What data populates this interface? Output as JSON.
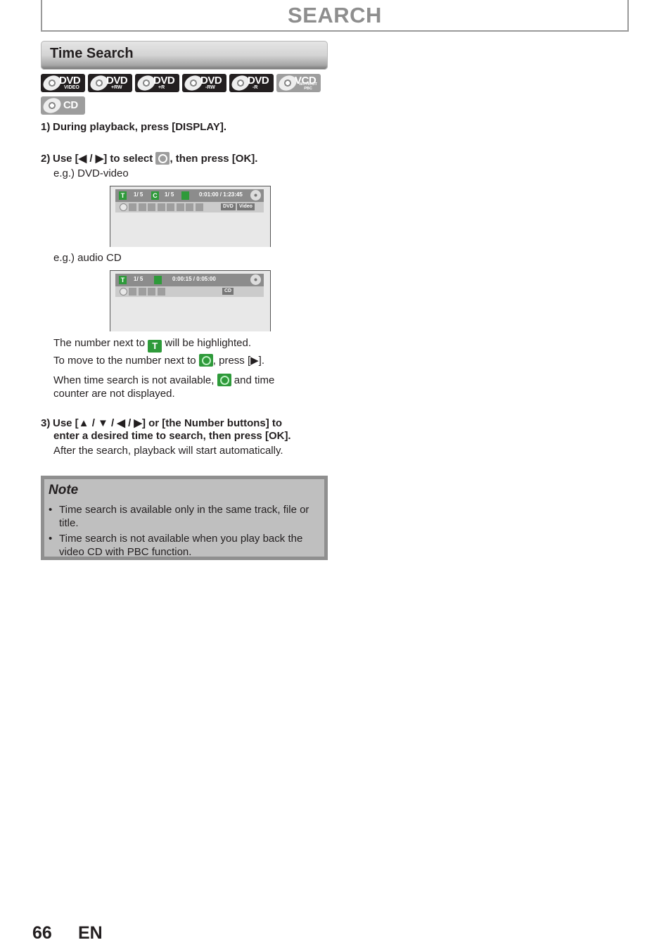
{
  "header": {
    "title": "SEARCH"
  },
  "section": {
    "title": "Time Search"
  },
  "disc_badges": [
    {
      "name": "DVD",
      "sub": "VIDEO",
      "style": "dark"
    },
    {
      "name": "DVD",
      "sub": "+RW",
      "style": "dark"
    },
    {
      "name": "DVD",
      "sub": "+R",
      "style": "dark"
    },
    {
      "name": "DVD",
      "sub": "-RW",
      "style": "dark"
    },
    {
      "name": "DVD",
      "sub": "-R",
      "style": "dark"
    },
    {
      "name": "VCD",
      "sub": "WITHOUT PBC",
      "style": "gray"
    },
    {
      "name": "CD",
      "sub": "",
      "style": "gray"
    }
  ],
  "steps": [
    {
      "num": "1)",
      "text": "During playback, press [DISPLAY]."
    },
    {
      "num": "2)",
      "text_before": "Use [◀ / ▶] to select",
      "icon": "time-search-icon",
      "text_after": ", then press [OK]."
    },
    {
      "num": "3)",
      "line1": "Use [▲ / ▼ / ◀ / ▶] or [the Number buttons] to",
      "line2": "enter a desired time to search, then press [OK].",
      "sub": "After the search, playback will start automatically."
    }
  ],
  "examples": {
    "dvd": {
      "label": "e.g.) DVD-video",
      "title_badge": "T",
      "title_value": "1/   5",
      "chapter_badge": "C",
      "chapter_value": "1/   5",
      "time": "0:01:00 / 1:23:45",
      "tags": [
        "DVD",
        "Video"
      ]
    },
    "cd": {
      "label": "e.g.) audio CD",
      "title_badge": "T",
      "track_value": "1/   5",
      "time": "0:00:15 / 0:05:00",
      "tags": [
        "CD"
      ]
    }
  },
  "info": {
    "line1_before": "The number next to",
    "line1_after": "will be highlighted.",
    "line2_before": "To move to the number next to",
    "line2_after": ", press [▶].",
    "line3_before": "When time search is not available,",
    "line3_after": "and time",
    "line4": "counter are not displayed.",
    "t_icon": "T"
  },
  "note": {
    "title": "Note",
    "items": [
      {
        "bullet": "•",
        "line1": "Time search is available only in the same track, file or",
        "line2": "title."
      },
      {
        "bullet": "•",
        "line1": "Time search is not available when you play back the",
        "line2": "video CD with PBC function."
      }
    ]
  },
  "footer": {
    "page": "66",
    "lang": "EN"
  }
}
